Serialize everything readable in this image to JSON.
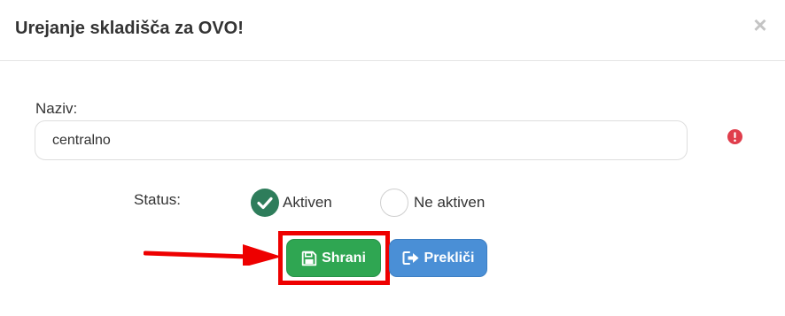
{
  "modal": {
    "title": "Urejanje skladišča za OVO!",
    "close_label": "×"
  },
  "form": {
    "name_label": "Naziv:",
    "name_value": "centralno",
    "status_label": "Status:",
    "status_options": [
      {
        "label": "Aktiven",
        "selected": true
      },
      {
        "label": "Ne aktiven",
        "selected": false
      }
    ]
  },
  "actions": {
    "save_label": "Shrani",
    "cancel_label": "Prekliči"
  },
  "colors": {
    "save": "#2fa652",
    "cancel": "#4a8fd6",
    "radio_checked": "#2e7d5b",
    "error_icon": "#e03e4c",
    "annotation": "#ee0000"
  },
  "icons": {
    "close": "close-icon",
    "error": "exclamation-circle-icon",
    "check": "check-icon",
    "save": "floppy-disk-icon",
    "cancel": "sign-out-icon",
    "annotation_arrow": "arrow-right-icon"
  }
}
